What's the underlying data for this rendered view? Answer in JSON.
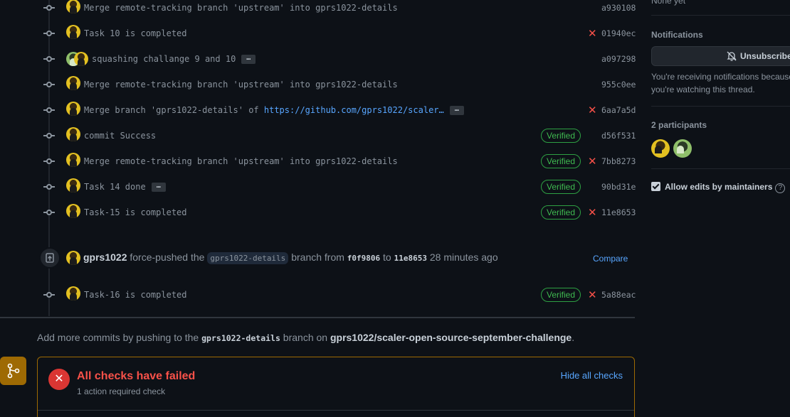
{
  "commits": [
    {
      "avatar": "yellow",
      "message": "Merge remote-tracking branch 'upstream' into gprs1022-details",
      "sha": "a930108",
      "verified": false,
      "failed": false,
      "has_ellipsis": false
    },
    {
      "avatar": "yellow",
      "message": "Task 10 is completed",
      "sha": "01940ec",
      "verified": false,
      "failed": true,
      "has_ellipsis": false
    },
    {
      "avatar": "pair",
      "message": "squashing challange 9 and 10",
      "sha": "a097298",
      "verified": false,
      "failed": false,
      "has_ellipsis": true
    },
    {
      "avatar": "yellow",
      "message": "Merge remote-tracking branch 'upstream' into gprs1022-details",
      "sha": "955c0ee",
      "verified": false,
      "failed": false,
      "has_ellipsis": false
    },
    {
      "avatar": "yellow",
      "message": "Merge branch 'gprs1022-details' of ",
      "link": "https://github.com/gprs1022/scaler…",
      "sha": "6aa7a5d",
      "verified": false,
      "failed": true,
      "has_ellipsis": true
    },
    {
      "avatar": "yellow",
      "message": "commit Success",
      "sha": "d56f531",
      "verified": true,
      "failed": false,
      "has_ellipsis": false
    },
    {
      "avatar": "yellow",
      "message": "Merge remote-tracking branch 'upstream' into gprs1022-details",
      "sha": "7bb8273",
      "verified": true,
      "failed": true,
      "has_ellipsis": false
    },
    {
      "avatar": "yellow",
      "message": "Task 14 done",
      "sha": "90bd31e",
      "verified": true,
      "failed": false,
      "has_ellipsis": true
    },
    {
      "avatar": "yellow",
      "message": "Task-15 is completed",
      "sha": "11e8653",
      "verified": true,
      "failed": true,
      "has_ellipsis": false
    }
  ],
  "last_commit": {
    "avatar": "yellow",
    "message": "Task-16 is completed",
    "sha": "5a88eac",
    "verified": true,
    "failed": true,
    "has_ellipsis": false
  },
  "verified_label": "Verified",
  "force_push": {
    "user": "gprs1022",
    "action": "force-pushed the",
    "branch": "gprs1022-details",
    "from_text": "branch from",
    "from_sha": "f0f9806",
    "to_text": "to",
    "to_sha": "11e8653",
    "time": "28 minutes ago",
    "compare_label": "Compare"
  },
  "add_more": {
    "prefix": "Add more commits by pushing to the",
    "branch": "gprs1022-details",
    "middle": "branch on",
    "repo": "gprs1022/scaler-open-source-september-challenge",
    "suffix": "."
  },
  "checks": {
    "title": "All checks have failed",
    "subtitle": "1 action required check",
    "hide_label": "Hide all checks"
  },
  "sidebar": {
    "top_text": "None yet",
    "notifications_heading": "Notifications",
    "unsubscribe_label": "Unsubscribe",
    "notif_text": "You're receiving notifications because you're watching this thread.",
    "participants_heading": "2 participants",
    "allow_edits_label": "Allow edits by maintainers",
    "help_glyph": "?"
  },
  "colors": {
    "accent": "#58a6ff",
    "success": "#3fb950",
    "danger": "#f85149",
    "warning_border": "#9e6a03",
    "background": "#0d1117"
  }
}
